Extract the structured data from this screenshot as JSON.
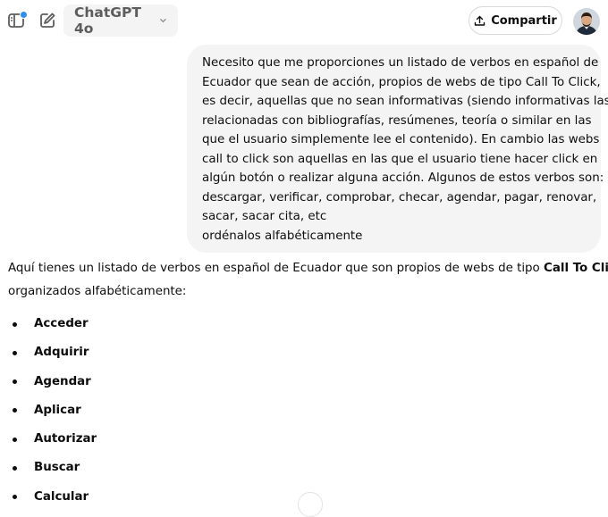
{
  "header": {
    "sidebar_icon": "sidebar-toggle-icon",
    "new_chat_icon": "new-chat-edit-icon",
    "model_label": "ChatGPT 4o",
    "share_label": "Compartir",
    "colors": {
      "notification_dot": "#2f8ff0",
      "model_bg": "#f4f4f4"
    }
  },
  "user_message": {
    "lines": [
      "Necesito que me proporciones un listado de verbos en español de",
      "Ecuador que sean de acción, propios de webs de tipo Call To Click,",
      "es decir, aquellas que no sean informativas (siendo informativas las",
      "relacionadas con bibliografías, resúmenes, teoría o similar en las",
      "que el usuario simplemente lee el contenido). En cambio las webs",
      "call to click son aquellas en las que el usuario tiene hacer click en",
      "algún botón o realizar alguna acción. Algunos de estos verbos son:",
      "descargar, verificar, comprobar, checar, agendar, pagar, renovar,",
      "sacar, sacar cita, etc",
      "ordénalos alfabéticamente"
    ]
  },
  "assistant_message": {
    "intro_line1_a": "Aquí tienes un listado de verbos en español de Ecuador que son propios de webs de tipo ",
    "intro_line1_bold": "Call To Click",
    "intro_line1_b": ",",
    "intro_line2": "organizados alfabéticamente:",
    "verbs": [
      "Acceder",
      "Adquirir",
      "Agendar",
      "Aplicar",
      "Autorizar",
      "Buscar",
      "Calcular"
    ]
  }
}
